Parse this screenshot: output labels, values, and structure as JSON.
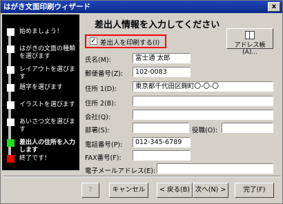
{
  "window": {
    "title": "はがき文面印刷ウィザード",
    "close_label": "x"
  },
  "steps": [
    {
      "label": "始めましょう！",
      "state": "done"
    },
    {
      "label": "はがきの文面の種類を選びます",
      "state": "done"
    },
    {
      "label": "レイアウトを選びます",
      "state": "done"
    },
    {
      "label": "題字を選びます",
      "state": "done"
    },
    {
      "label": "イラストを選びます",
      "state": "done"
    },
    {
      "label": "あいさつ文を選びます",
      "state": "done"
    },
    {
      "label": "差出人の住所を入力します",
      "state": "current"
    },
    {
      "label": "終了です！",
      "state": "end"
    }
  ],
  "heading": "差出人情報を入力してください",
  "address_book_button": "アドレス帳(A)...",
  "print_sender_checkbox": {
    "label": "差出人を印刷する(I)",
    "checked": true,
    "mark": "✓"
  },
  "fields": {
    "name": {
      "label": "氏名(M):",
      "value": "富士通 太郎"
    },
    "postal": {
      "label": "郵便番号(Z):",
      "value": "102-0083"
    },
    "address1": {
      "label": "住所 1(D):",
      "value": "東京都千代田区麹町〇-〇-〇"
    },
    "address2": {
      "label": "住所 2(B):",
      "value": ""
    },
    "company": {
      "label": "会社(Q):",
      "value": ""
    },
    "department": {
      "label": "部署(S):",
      "value": ""
    },
    "title": {
      "label": "役職(O):",
      "value": ""
    },
    "phone": {
      "label": "電話番号(P):",
      "value": "012-345-6789"
    },
    "fax": {
      "label": "FAX番号(F):",
      "value": ""
    },
    "email": {
      "label": "電子メールアドレス(E):",
      "value": ""
    }
  },
  "buttons": {
    "help": "?",
    "cancel": "キャンセル",
    "back": "< 戻る(B)",
    "next": "次へ(N) >",
    "finish": "完了(F)"
  }
}
